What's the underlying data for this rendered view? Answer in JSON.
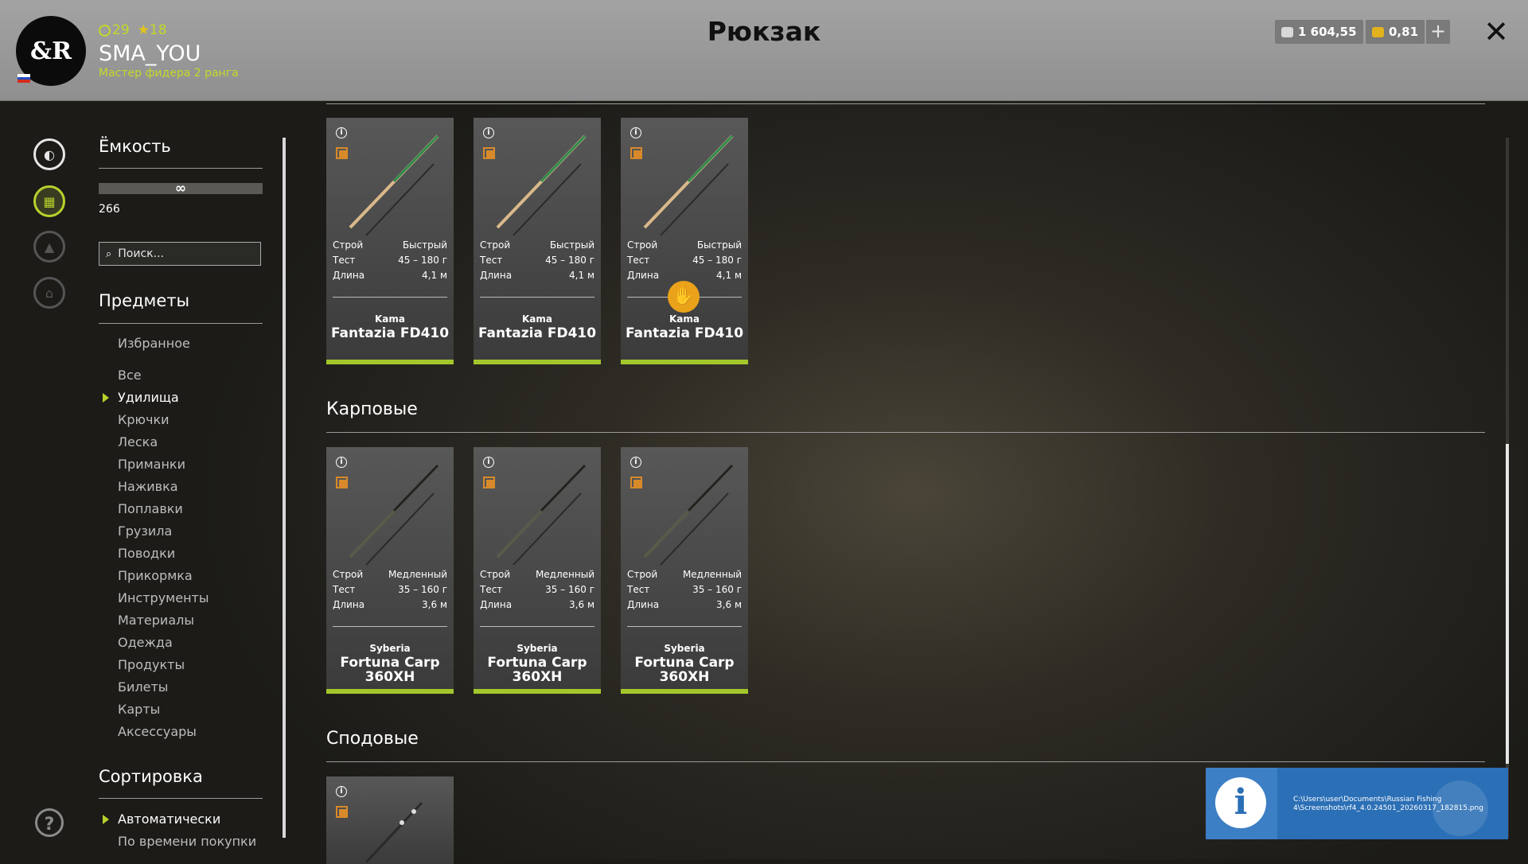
{
  "header": {
    "title": "Рюкзак",
    "avatar_text": "&R",
    "level": "29",
    "stars": "18",
    "username": "SMA_YOU",
    "rank": "Мастер фидера 2 ранга",
    "silver": "1 604,55",
    "gold": "0,81",
    "plus_label": "+",
    "close_label": "✕"
  },
  "panel": {
    "capacity_title": "Ёмкость",
    "capacity_symbol": "∞",
    "capacity_value": "266",
    "search_placeholder": "Поиск...",
    "items_title": "Предметы",
    "favorites": "Избранное",
    "categories": [
      "Все",
      "Удилища",
      "Крючки",
      "Леска",
      "Приманки",
      "Наживка",
      "Поплавки",
      "Грузила",
      "Поводки",
      "Прикормка",
      "Инструменты",
      "Материалы",
      "Одежда",
      "Продукты",
      "Билеты",
      "Карты",
      "Аксессуары"
    ],
    "active_category": "Удилища",
    "sort_title": "Сортировка",
    "sort_options": [
      "Автоматически",
      "По времени покупки"
    ],
    "active_sort": "Автоматически"
  },
  "sections": [
    {
      "title": "",
      "cards": [
        {
          "labels": [
            "Строй",
            "Тест",
            "Длина"
          ],
          "values": [
            "Быстрый",
            "45 – 180 г",
            "4,1 м"
          ],
          "brand": "Kama",
          "model": "Fantazia FD410",
          "badge": false
        },
        {
          "labels": [
            "Строй",
            "Тест",
            "Длина"
          ],
          "values": [
            "Быстрый",
            "45 – 180 г",
            "4,1 м"
          ],
          "brand": "Kama",
          "model": "Fantazia FD410",
          "badge": false
        },
        {
          "labels": [
            "Строй",
            "Тест",
            "Длина"
          ],
          "values": [
            "Быстрый",
            "45 – 180 г",
            "4,1 м"
          ],
          "brand": "Kama",
          "model": "Fantazia FD410",
          "badge": true
        }
      ]
    },
    {
      "title": "Карповые",
      "cards": [
        {
          "labels": [
            "Строй",
            "Тест",
            "Длина"
          ],
          "values": [
            "Медленный",
            "35 – 160 г",
            "3,6 м"
          ],
          "brand": "Syberia",
          "model": "Fortuna Carp 360XH",
          "badge": false
        },
        {
          "labels": [
            "Строй",
            "Тест",
            "Длина"
          ],
          "values": [
            "Медленный",
            "35 – 160 г",
            "3,6 м"
          ],
          "brand": "Syberia",
          "model": "Fortuna Carp 360XH",
          "badge": false
        },
        {
          "labels": [
            "Строй",
            "Тест",
            "Длина"
          ],
          "values": [
            "Медленный",
            "35 – 160 г",
            "3,6 м"
          ],
          "brand": "Syberia",
          "model": "Fortuna Carp 360XH",
          "badge": false
        }
      ]
    },
    {
      "title": "Сподовые",
      "cards": []
    }
  ],
  "notification": {
    "path": "C:\\Users\\user\\Documents\\Russian Fishing 4\\Screenshots\\rf4_4.0.24501_20260317_182815.png"
  },
  "colors": {
    "accent": "#a3c72b",
    "rank": "#c4d82a",
    "badge": "#e9a21a",
    "notification": "#2b6fb6"
  }
}
